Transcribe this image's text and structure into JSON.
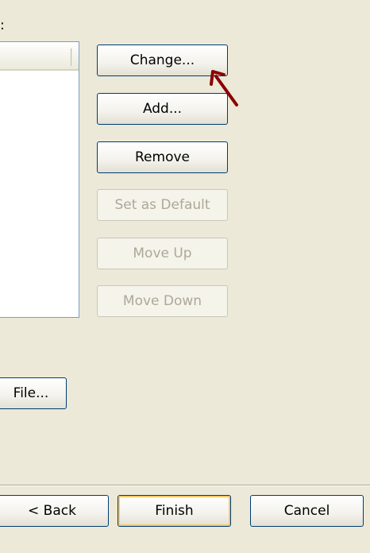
{
  "window": {
    "label_colon": ":"
  },
  "buttons": {
    "change": "Change...",
    "add": "Add...",
    "remove": "Remove",
    "set_default": "Set as Default",
    "move_up": "Move Up",
    "move_down": "Move Down",
    "file": "File...",
    "back": "< Back",
    "finish": "Finish",
    "cancel": "Cancel"
  },
  "annotation": {
    "arrow_color": "#8b0000"
  }
}
